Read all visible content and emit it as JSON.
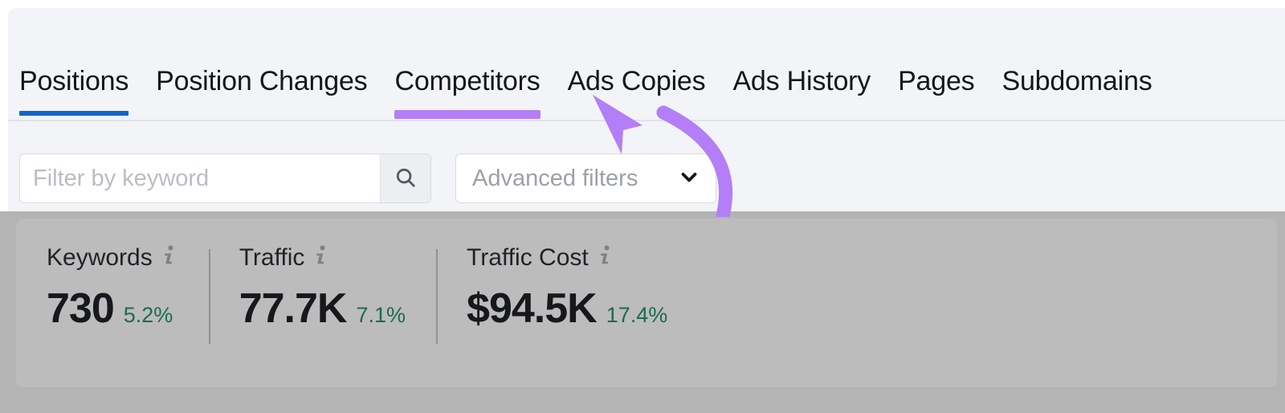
{
  "colors": {
    "active_tab_underline": "#1166c6",
    "annotation_purple": "#b37ef7",
    "delta_green": "#1a6b50",
    "panel_background": "#f2f4f8",
    "dim_overlay": "#b4b4b4",
    "metrics_card": "#bcbcbc"
  },
  "tabs": [
    {
      "label": "Positions",
      "state": "active"
    },
    {
      "label": "Position Changes",
      "state": "default"
    },
    {
      "label": "Competitors",
      "state": "annotated"
    },
    {
      "label": "Ads Copies",
      "state": "default"
    },
    {
      "label": "Ads History",
      "state": "default"
    },
    {
      "label": "Pages",
      "state": "default"
    },
    {
      "label": "Subdomains",
      "state": "default"
    }
  ],
  "filters": {
    "search": {
      "value": "",
      "placeholder": "Filter by keyword",
      "icon": "search-icon",
      "button_icon": "magnifier-icon"
    },
    "advanced": {
      "label": "Advanced filters",
      "icon": "chevron-down-icon"
    }
  },
  "metrics": [
    {
      "title": "Keywords",
      "value": "730",
      "delta": "5.2%",
      "info_icon": "info-icon",
      "has_divider": false
    },
    {
      "title": "Traffic",
      "value": "77.7K",
      "delta": "7.1%",
      "info_icon": "info-icon",
      "has_divider": true
    },
    {
      "title": "Traffic Cost",
      "value": "$94.5K",
      "delta": "17.4%",
      "info_icon": "info-icon",
      "has_divider": true
    }
  ],
  "annotation": {
    "type": "curved-arrow",
    "points_to": "Competitors",
    "color": "#b37ef7",
    "underline_target": "Competitors"
  }
}
